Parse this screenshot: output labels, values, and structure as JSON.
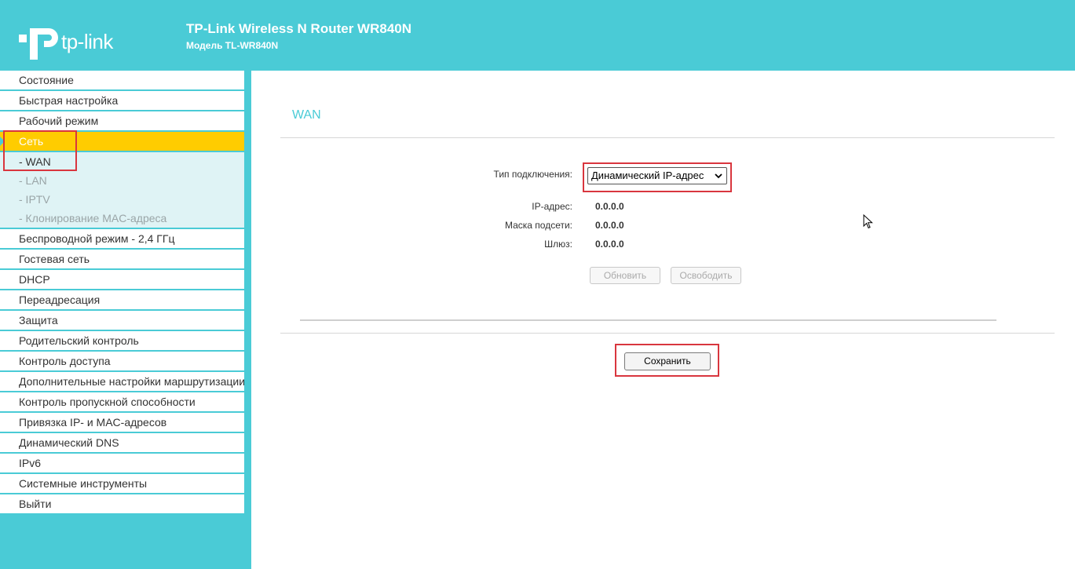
{
  "header": {
    "logo_text": "tp-link",
    "title": "TP-Link Wireless N Router WR840N",
    "subtitle": "Модель TL-WR840N",
    "bg_color": "#4acbd6"
  },
  "sidebar": {
    "items_top": [
      {
        "label": "Состояние"
      },
      {
        "label": "Быстрая настройка"
      },
      {
        "label": "Рабочий режим"
      }
    ],
    "active_item": {
      "label": "Сеть",
      "color": "#ffcc00"
    },
    "sub_items": [
      {
        "label": "- WAN",
        "active": true
      },
      {
        "label": "- LAN"
      },
      {
        "label": "- IPTV"
      },
      {
        "label": "- Клонирование MAC-адреса"
      }
    ],
    "items_bottom": [
      {
        "label": "Беспроводной режим - 2,4 ГГц"
      },
      {
        "label": "Гостевая сеть"
      },
      {
        "label": "DHCP"
      },
      {
        "label": "Переадресация"
      },
      {
        "label": "Защита"
      },
      {
        "label": "Родительский контроль"
      },
      {
        "label": "Контроль доступа"
      },
      {
        "label": "Дополнительные настройки маршрутизации"
      },
      {
        "label": "Контроль пропускной способности"
      },
      {
        "label": "Привязка IP- и MAC-адресов"
      },
      {
        "label": "Динамический DNS"
      },
      {
        "label": "IPv6"
      },
      {
        "label": "Системные инструменты"
      },
      {
        "label": "Выйти"
      }
    ]
  },
  "main": {
    "section_title": "WAN",
    "connection_type_label": "Тип подключения:",
    "connection_type_value": "Динамический IP-адрес",
    "ip_label": "IP-адрес:",
    "ip_value": "0.0.0.0",
    "mask_label": "Маска подсети:",
    "mask_value": "0.0.0.0",
    "gateway_label": "Шлюз:",
    "gateway_value": "0.0.0.0",
    "renew_label": "Обновить",
    "release_label": "Освободить",
    "save_label": "Сохранить",
    "highlight_color": "#d9363e"
  }
}
